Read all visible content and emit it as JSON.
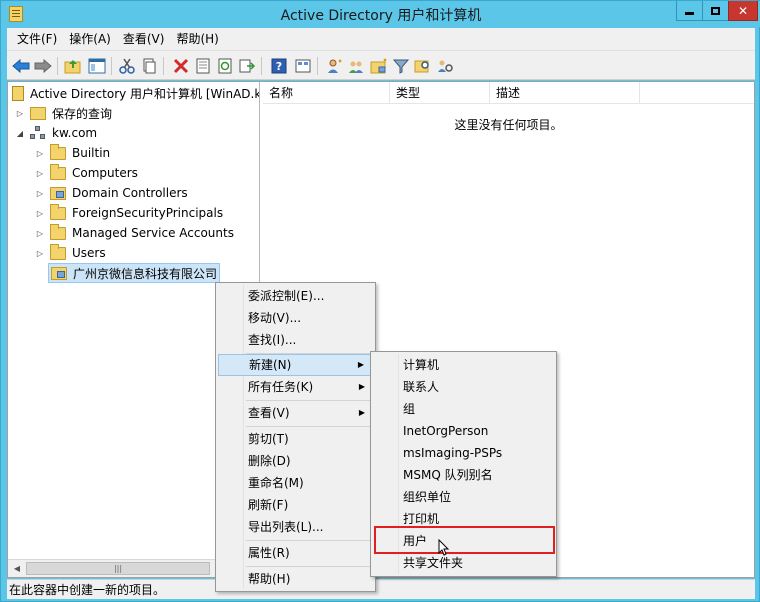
{
  "window": {
    "title": "Active Directory 用户和计算机"
  },
  "menubar": {
    "items": [
      "文件(F)",
      "操作(A)",
      "查看(V)",
      "帮助(H)"
    ]
  },
  "toolbar": {
    "icons": [
      "back-icon",
      "forward-icon",
      "up-folder-icon",
      "show-tree-icon",
      "cut-icon",
      "copy-icon",
      "delete-icon",
      "properties-icon",
      "refresh-icon",
      "export-icon",
      "help-icon",
      "view-icon",
      "add-user-icon",
      "add-group-icon",
      "add-ou-icon",
      "filter-icon",
      "find-icon",
      "delegate-icon"
    ]
  },
  "tree": {
    "root": "Active Directory 用户和计算机 [WinAD.k",
    "saved_queries": "保存的查询",
    "domain": "kw.com",
    "children": [
      "Builtin",
      "Computers",
      "Domain Controllers",
      "ForeignSecurityPrincipals",
      "Managed Service Accounts",
      "Users",
      "广州京微信息科技有限公司"
    ]
  },
  "list": {
    "columns": [
      "名称",
      "类型",
      "描述"
    ],
    "empty_message": "这里没有任何项目。"
  },
  "context_menu": {
    "items": [
      "委派控制(E)...",
      "移动(V)...",
      "查找(I)...",
      "新建(N)",
      "所有任务(K)",
      "查看(V)",
      "剪切(T)",
      "删除(D)",
      "重命名(M)",
      "刷新(F)",
      "导出列表(L)...",
      "属性(R)",
      "帮助(H)"
    ]
  },
  "submenu": {
    "items": [
      "计算机",
      "联系人",
      "组",
      "InetOrgPerson",
      "msImaging-PSPs",
      "MSMQ 队列别名",
      "组织单位",
      "打印机",
      "用户",
      "共享文件夹"
    ]
  },
  "statusbar": {
    "text": "在此容器中创建一新的项目。"
  },
  "colors": {
    "title_bar": "#5bc6e8",
    "close_button": "#c7372f",
    "highlight_box": "#e02020",
    "menu_highlight": "#d5e8f7"
  }
}
